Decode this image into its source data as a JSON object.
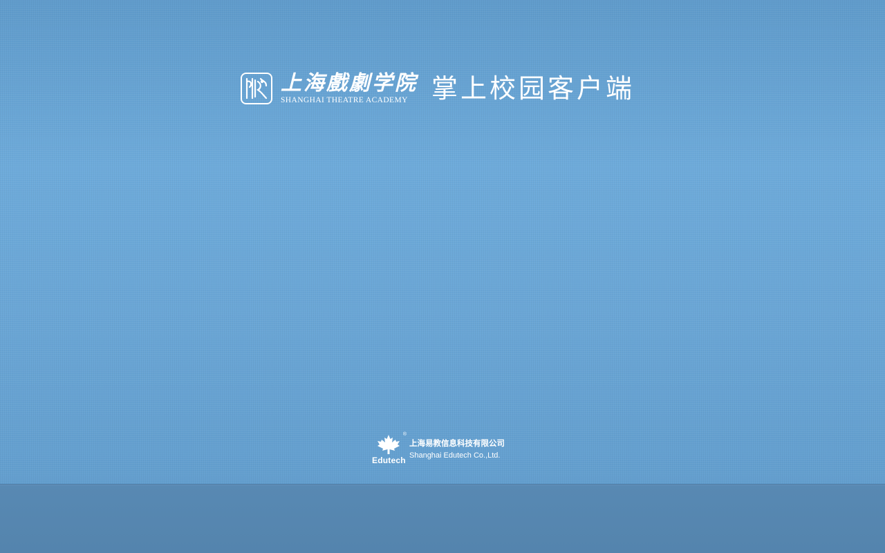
{
  "header": {
    "academy_name_cn": "上海戲劇学院",
    "academy_name_en": "SHANGHAI THEATRE ACADEMY",
    "app_title": "掌上校园客户端",
    "logo_icon": "theatre-academy-emblem-icon"
  },
  "footer": {
    "brand_word": "Edutech",
    "registered_mark": "®",
    "logo_icon": "maple-leaf-icon",
    "company_cn": "上海易教信息科技有限公司",
    "company_en": "Shanghai Edutech Co.,Ltd."
  },
  "colors": {
    "background": "#6aa6d6",
    "bottom_bar": "#5686af",
    "text": "#ffffff"
  }
}
